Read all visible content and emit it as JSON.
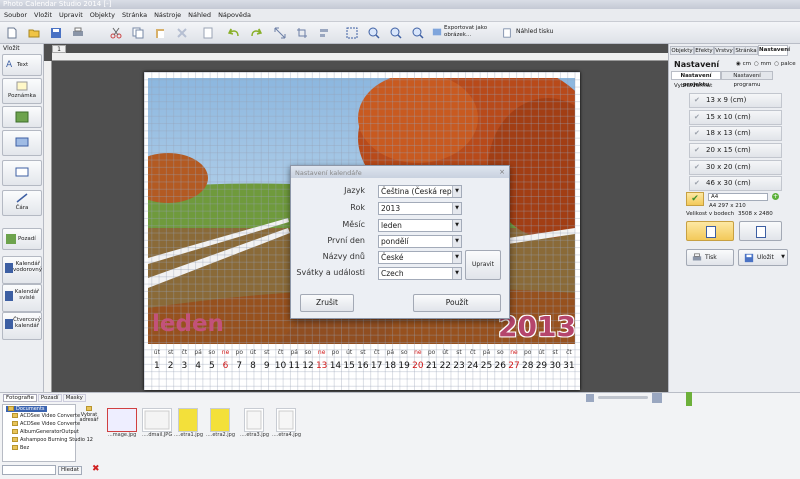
{
  "app": {
    "title": "Photo Calendar Studio 2014 [-]"
  },
  "menu": [
    "Soubor",
    "Vložit",
    "Upravit",
    "Objekty",
    "Stránka",
    "Nástroje",
    "Náhled",
    "Nápověda"
  ],
  "toolbar": {
    "export_label": "Exportovat jako obrázek...",
    "preview_label": "Náhled tisku"
  },
  "left_panel": {
    "header": "Vložit",
    "items": [
      "Text",
      "Poznámka",
      "",
      "",
      "Čára",
      "Pozadí",
      "Kalendář vodorovný",
      "Kalendář svislé",
      "Čtvercový kalendář"
    ]
  },
  "page_tab": "1",
  "calendar": {
    "month": "leden",
    "year": "2013",
    "day_names": [
      "út",
      "st",
      "čt",
      "pá",
      "so",
      "ne",
      "po",
      "út",
      "st",
      "čt",
      "pá",
      "so",
      "ne",
      "po",
      "út",
      "st",
      "čt",
      "pá",
      "so",
      "ne",
      "po",
      "út",
      "st",
      "čt",
      "pá",
      "so",
      "ne",
      "po",
      "út",
      "st",
      "čt"
    ],
    "day_numbers": [
      "1",
      "2",
      "3",
      "4",
      "5",
      "6",
      "7",
      "8",
      "9",
      "10",
      "11",
      "12",
      "13",
      "14",
      "15",
      "16",
      "17",
      "18",
      "19",
      "20",
      "21",
      "22",
      "23",
      "24",
      "25",
      "26",
      "27",
      "28",
      "29",
      "30",
      "31"
    ],
    "sunday_indices": [
      5,
      12,
      19,
      26
    ]
  },
  "dialog": {
    "title": "Nastavení kalendáře",
    "fields": [
      {
        "label": "Jazyk",
        "value": "Čeština (Česká repub"
      },
      {
        "label": "Rok",
        "value": "2013"
      },
      {
        "label": "Měsíc",
        "value": "leden"
      },
      {
        "label": "První den",
        "value": "pondělí"
      },
      {
        "label": "Názvy dnů",
        "value": "České"
      },
      {
        "label": "Svátky a události",
        "value": "Czech"
      }
    ],
    "edit_button": "Upravit",
    "cancel_button": "Zrušit",
    "apply_button": "Použít"
  },
  "right_panel": {
    "tabs": [
      "Objekty",
      "Efekty",
      "Vrstvy",
      "Stránka",
      "Nastavení"
    ],
    "title": "Nastavení",
    "units": [
      "cm",
      "mm",
      "palce"
    ],
    "subtabs": [
      "Nastavení projektu",
      "Nastavení programu"
    ],
    "format_label": "Vybrat formát",
    "formats": [
      "13 x 9 (cm)",
      "15 x 10 (cm)",
      "18 x 13 (cm)",
      "20 x 15 (cm)",
      "30 x 20 (cm)",
      "46 x 30 (cm)"
    ],
    "selected_format": "A4",
    "selected_size": "A4 297 x 210",
    "pixel_size_label": "Velikost v bodech",
    "pixel_size": "3508 x 2480",
    "print_button": "Tisk",
    "save_button": "Uložit"
  },
  "bottom": {
    "tabs": [
      "Fotografie",
      "Pozadí",
      "Masky"
    ],
    "tree": [
      "Documents",
      "ACDSee Video Converte",
      "ACDSee Video Converte",
      "AlbumGeneratorOutput",
      "Ashampoo Burning Studio 12",
      "Bez"
    ],
    "select_label": "Vybrat adresář",
    "search_label": "Hledat",
    "thumbnails": [
      "...mage.jpg",
      "....dmail.JPG",
      "....etra1.jpg",
      "....etra2.jpg",
      "....etra3.jpg",
      "....etra4.jpg"
    ]
  },
  "colors": {
    "month_pink": "#c2527a",
    "sunday_red": "#d01818",
    "accent_blue": "#3a63b0"
  }
}
